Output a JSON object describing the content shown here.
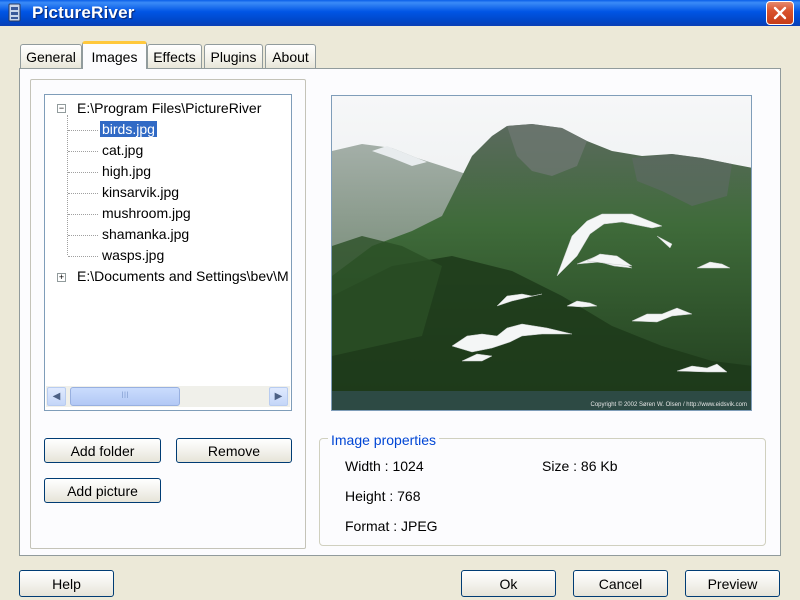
{
  "window": {
    "title": "PictureRiver"
  },
  "tabs": [
    {
      "label": "General",
      "active": false
    },
    {
      "label": "Images",
      "active": true
    },
    {
      "label": "Effects",
      "active": false
    },
    {
      "label": "Plugins",
      "active": false
    },
    {
      "label": "About",
      "active": false
    }
  ],
  "tree": {
    "root1": {
      "label": "E:\\Program Files\\PictureRiver",
      "expanded": true
    },
    "files": [
      "birds.jpg",
      "cat.jpg",
      "high.jpg",
      "kinsarvik.jpg",
      "mushroom.jpg",
      "shamanka.jpg",
      "wasps.jpg"
    ],
    "selected_file": "birds.jpg",
    "root2": {
      "label": "E:\\Documents and Settings\\bev\\M",
      "expanded": false
    },
    "scrollbar_thumb_glyph": "III"
  },
  "buttons": {
    "add_folder": "Add folder",
    "remove": "Remove",
    "add_picture": "Add picture",
    "help": "Help",
    "ok": "Ok",
    "cancel": "Cancel",
    "preview": "Preview"
  },
  "preview": {
    "image_subject": "seagulls flying over fjord with green mountains",
    "copyright_text": "Copyright © 2002 Søren W. Olsen / http://www.eidsvik.com"
  },
  "image_properties": {
    "legend": "Image properties",
    "width": "Width : 1024",
    "height": "Height : 768",
    "format": "Format : JPEG",
    "size": "Size : 86 Kb"
  },
  "colors": {
    "titlebar": "#0055e5",
    "selection": "#316ac5",
    "group_legend": "#0046d5",
    "tab_highlight": "#ffc83c",
    "close_button": "#d9532e"
  },
  "icons": {
    "app": "picture-river-app-icon",
    "close": "close-icon",
    "expand": "plus-expander-icon",
    "collapse": "minus-expander-icon",
    "scroll_left": "scroll-left-arrow-icon",
    "scroll_right": "scroll-right-arrow-icon"
  }
}
